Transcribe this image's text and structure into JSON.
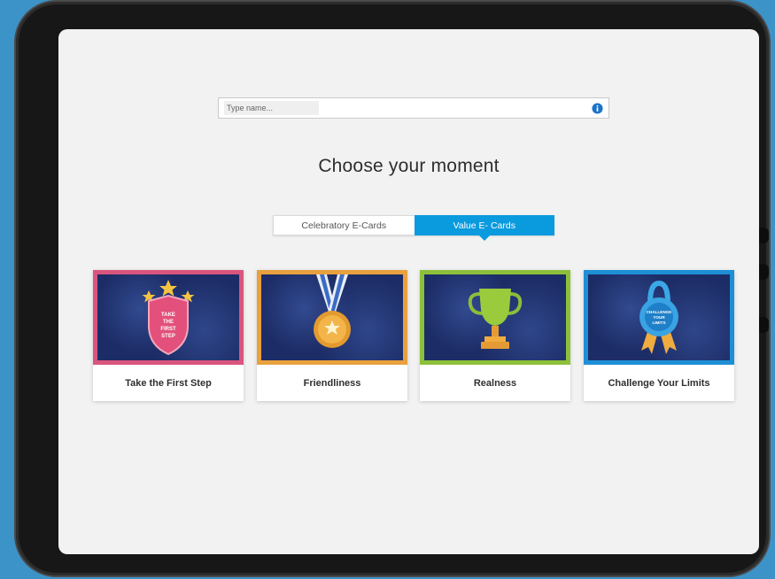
{
  "search": {
    "placeholder": "Type name...",
    "info_icon": "info-icon"
  },
  "page_title": "Choose your moment",
  "tabs": [
    {
      "label": "Celebratory E-Cards",
      "active": false
    },
    {
      "label": "Value E- Cards",
      "active": true
    }
  ],
  "cards": [
    {
      "label": "Take the First Step",
      "badge_text": "TAKE THE FIRST STEP",
      "frame_color": "#d9557d",
      "icon": "shield-stars-icon"
    },
    {
      "label": "Friendliness",
      "badge_text": "",
      "frame_color": "#e8a13e",
      "icon": "medal-icon"
    },
    {
      "label": "Realness",
      "badge_text": "",
      "frame_color": "#8dc03a",
      "icon": "trophy-icon"
    },
    {
      "label": "Challenge Your Limits",
      "badge_text": "CHALLENGE YOUR LIMITS",
      "frame_color": "#1e8fd6",
      "icon": "kettlebell-icon"
    }
  ],
  "colors": {
    "background": "#3c93c8",
    "active_tab": "#0a9ade",
    "info_icon": "#1a73c8"
  }
}
